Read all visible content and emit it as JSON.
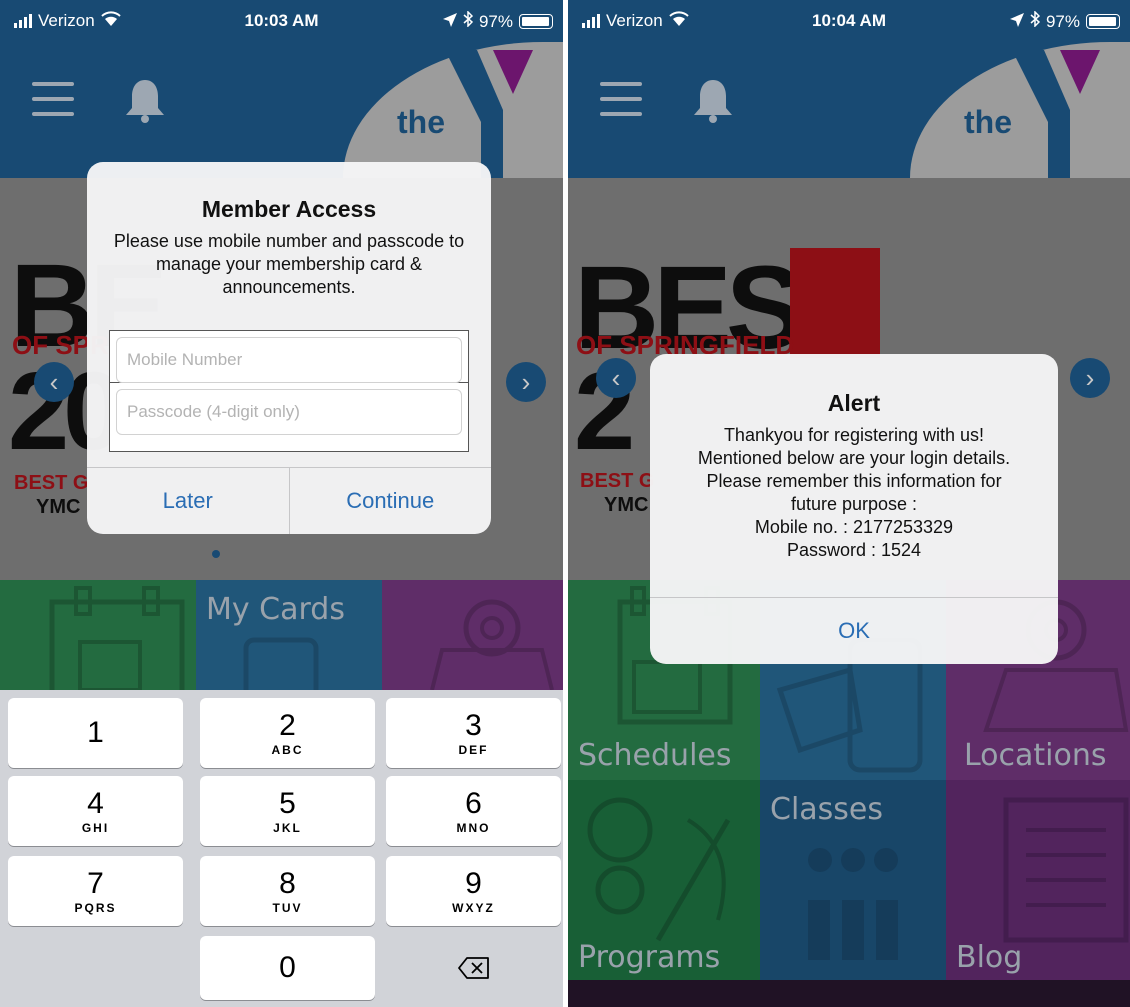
{
  "left": {
    "status": {
      "carrier": "Verizon",
      "time": "10:03 AM",
      "battery": "97%"
    },
    "header": {
      "logo_text": "the",
      "logo_side": "YMCA"
    },
    "banner": {
      "line1": "BE",
      "line2": "OF SPR",
      "line3": "20",
      "badge1": "BEST G",
      "badge2": "YMC"
    },
    "tiles": {
      "my_cards": "My Cards"
    },
    "dialog": {
      "title": "Member Access",
      "message": "Please use mobile number and passcode to manage your membership card & announcements.",
      "mobile_placeholder": "Mobile Number",
      "passcode_placeholder": "Passcode (4-digit only)",
      "later": "Later",
      "continue": "Continue"
    },
    "keyboard": {
      "keys": [
        {
          "num": "1",
          "letters": ""
        },
        {
          "num": "2",
          "letters": "ABC"
        },
        {
          "num": "3",
          "letters": "DEF"
        },
        {
          "num": "4",
          "letters": "GHI"
        },
        {
          "num": "5",
          "letters": "JKL"
        },
        {
          "num": "6",
          "letters": "MNO"
        },
        {
          "num": "7",
          "letters": "PQRS"
        },
        {
          "num": "8",
          "letters": "TUV"
        },
        {
          "num": "9",
          "letters": "WXYZ"
        },
        {
          "num": "0",
          "letters": ""
        }
      ],
      "delete_icon": "backspace-icon"
    }
  },
  "right": {
    "status": {
      "carrier": "Verizon",
      "time": "10:04 AM",
      "battery": "97%"
    },
    "header": {
      "logo_text": "the",
      "logo_side": "YMCA"
    },
    "banner": {
      "line1": "BEST",
      "line2": "OF SPRINGFIELD",
      "line3": "2",
      "badge1": "BEST G",
      "badge2": "YMC"
    },
    "tiles": {
      "schedules": "Schedules",
      "locations": "Locations",
      "classes": "Classes",
      "programs": "Programs",
      "blog": "Blog"
    },
    "alert": {
      "title": "Alert",
      "line1": "Thankyou for registering with us!",
      "line2": "Mentioned below are your login details.",
      "line3": "Please remember this information for",
      "line4": "future purpose :",
      "line5": "Mobile no. : 2177253329",
      "line6": "Password : 1524",
      "ok": "OK"
    }
  },
  "colors": {
    "header_blue": "#1f5f94",
    "tile_green": "#2e8a52",
    "tile_blue": "#2a6f9c",
    "tile_purple": "#7a3a86",
    "ymca_purple": "#8b1c8c",
    "ios_link": "#2a6db4"
  }
}
